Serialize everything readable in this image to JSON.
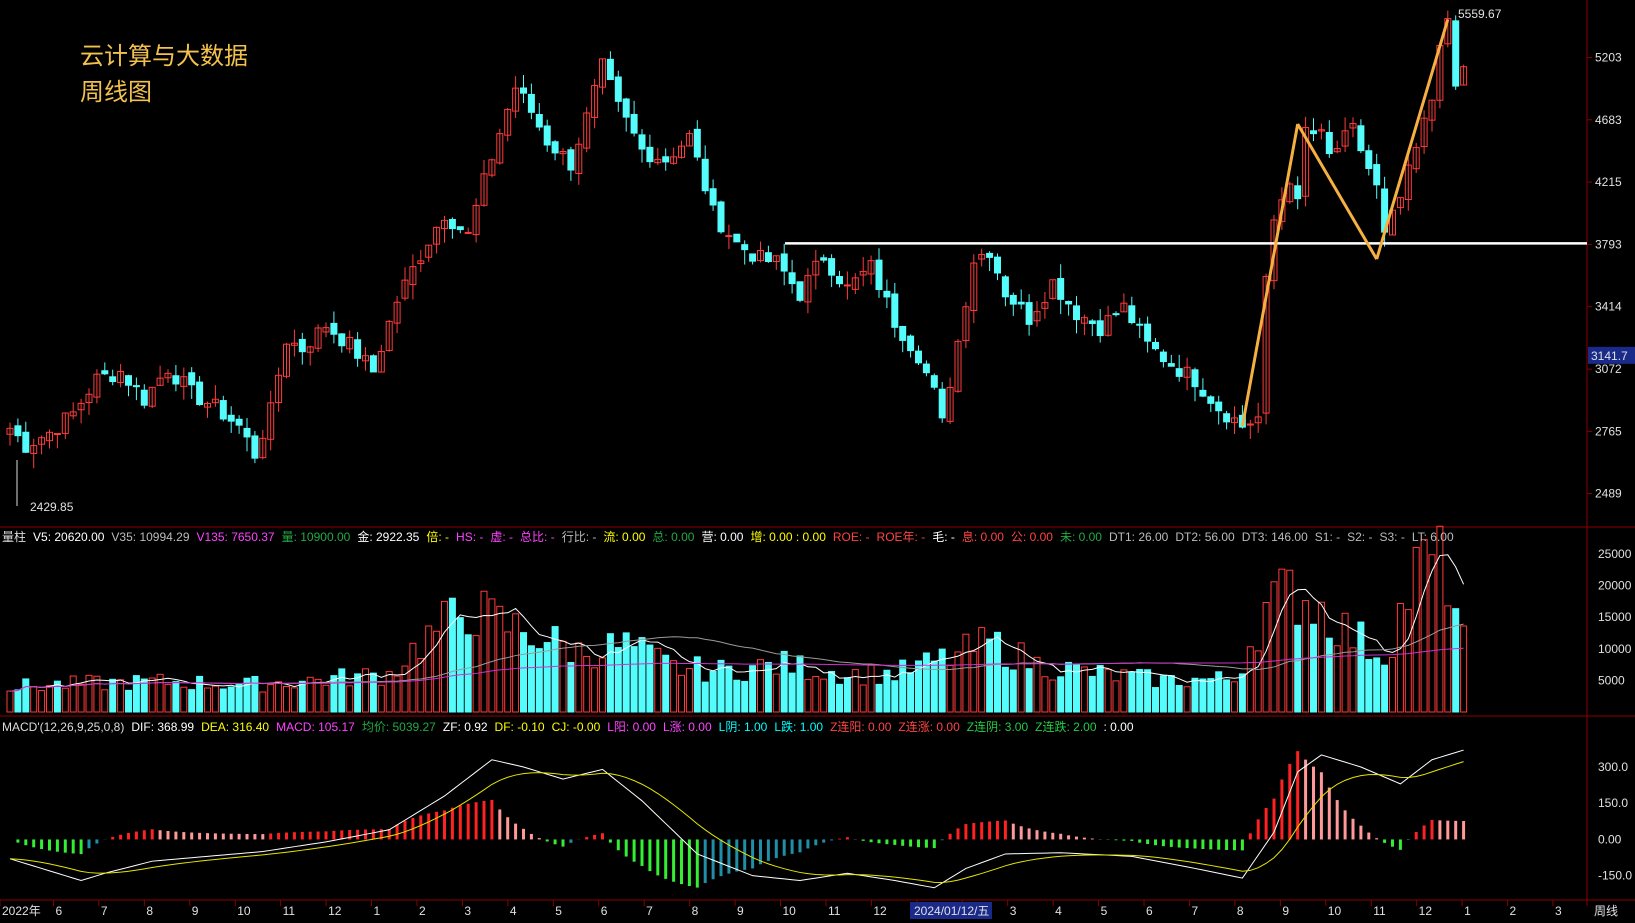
{
  "title": {
    "line1": "云计算与大数据",
    "line2": "周线图"
  },
  "price_axis": {
    "ticks": [
      "5203",
      "4683",
      "4215",
      "3793",
      "3414",
      "3072",
      "2765",
      "2489"
    ],
    "current": "3141.7",
    "high_label": "5559.67",
    "low_label": "2429.85"
  },
  "volume_axis": {
    "ticks": [
      "25000",
      "20000",
      "15000",
      "10000",
      "5000"
    ]
  },
  "macd_axis": {
    "ticks": [
      "300.0",
      "150.0",
      "0.00",
      "-150.0"
    ]
  },
  "vol_stats": [
    {
      "t": "量柱",
      "c": "#dddddd"
    },
    {
      "t": "V5: 20620.00",
      "c": "#ffffff"
    },
    {
      "t": "V35: 10994.29",
      "c": "#bbbbbb"
    },
    {
      "t": "V135: 7650.37",
      "c": "#ff44ff"
    },
    {
      "t": "量: 10900.00",
      "c": "#22aa44"
    },
    {
      "t": "金: 2922.35",
      "c": "#ffffff"
    },
    {
      "t": "倍: -",
      "c": "#ffff00"
    },
    {
      "t": "HS: -",
      "c": "#ff44ff"
    },
    {
      "t": "虚: -",
      "c": "#ff44ff"
    },
    {
      "t": "总比: -",
      "c": "#ff44ff"
    },
    {
      "t": "行比: -",
      "c": "#bbbbbb"
    },
    {
      "t": "流: 0.00",
      "c": "#ffff00"
    },
    {
      "t": "总: 0.00",
      "c": "#22aa44"
    },
    {
      "t": "营: 0.00",
      "c": "#ffffff"
    },
    {
      "t": "增: 0.00 : 0.00",
      "c": "#ffff00"
    },
    {
      "t": "ROE: -",
      "c": "#ff4444"
    },
    {
      "t": "ROE年: -",
      "c": "#ff4444"
    },
    {
      "t": "毛: -",
      "c": "#ffffff"
    },
    {
      "t": "息: 0.00",
      "c": "#ff4444"
    },
    {
      "t": "公: 0.00",
      "c": "#ff4444"
    },
    {
      "t": "未: 0.00",
      "c": "#22aa44"
    },
    {
      "t": "DT1: 26.00",
      "c": "#bbbbbb"
    },
    {
      "t": "DT2: 56.00",
      "c": "#bbbbbb"
    },
    {
      "t": "DT3: 146.00",
      "c": "#bbbbbb"
    },
    {
      "t": "S1: -",
      "c": "#bbbbbb"
    },
    {
      "t": "S2: -",
      "c": "#bbbbbb"
    },
    {
      "t": "S3: -",
      "c": "#bbbbbb"
    },
    {
      "t": "LT: 6.00",
      "c": "#bbbbbb"
    }
  ],
  "macd_stats": [
    {
      "t": "MACD'(12,26,9,25,0,8)",
      "c": "#dddddd"
    },
    {
      "t": "DIF: 368.99",
      "c": "#ffffff"
    },
    {
      "t": "DEA: 316.40",
      "c": "#ffff00"
    },
    {
      "t": "MACD: 105.17",
      "c": "#ff44ff"
    },
    {
      "t": "均价: 5039.27",
      "c": "#22aa44"
    },
    {
      "t": "ZF: 0.92",
      "c": "#ffffff"
    },
    {
      "t": "DF: -0.10",
      "c": "#ffff00"
    },
    {
      "t": "CJ: -0.00",
      "c": "#ffff00"
    },
    {
      "t": "L阳: 0.00",
      "c": "#ff44ff"
    },
    {
      "t": "L涨: 0.00",
      "c": "#ff44ff"
    },
    {
      "t": "L阴: 1.00",
      "c": "#00ffff"
    },
    {
      "t": "L跌: 1.00",
      "c": "#00ffff"
    },
    {
      "t": "Z连阳: 0.00",
      "c": "#ff4444"
    },
    {
      "t": "Z连涨: 0.00",
      "c": "#ff4444"
    },
    {
      "t": "Z连阴: 3.00",
      "c": "#22cc44"
    },
    {
      "t": "Z连跌: 2.00",
      "c": "#22cc44"
    },
    {
      "t": ": 0.00",
      "c": "#ffffff"
    }
  ],
  "x_axis": {
    "labels": [
      "2022年",
      "6",
      "7",
      "8",
      "9",
      "10",
      "11",
      "12",
      "1",
      "2",
      "3",
      "4",
      "5",
      "6",
      "7",
      "8",
      "9",
      "10",
      "11",
      "12",
      "1",
      "2",
      "3",
      "4",
      "5",
      "6",
      "7",
      "8",
      "9",
      "10",
      "11",
      "12",
      "1",
      "2",
      "3"
    ],
    "cursor_date": "2024/01/12/五",
    "period": "周线"
  },
  "colors": {
    "up": "#ff3b3b",
    "down": "#54fcfc",
    "support_line": "#ffffff",
    "arrow": "#f5b041",
    "dif": "#ffffff",
    "dea": "#e5e500"
  },
  "chart_data": {
    "type": "candlestick",
    "support_level": 3800,
    "ylim_price": [
      2380,
      5620
    ],
    "ylim_volume": [
      0,
      28000
    ],
    "ylim_macd": [
      -230,
      420
    ],
    "anchors": [
      [
        0,
        2780
      ],
      [
        2,
        2700
      ],
      [
        5,
        2760
      ],
      [
        8,
        2850
      ],
      [
        11,
        3020
      ],
      [
        14,
        3060
      ],
      [
        17,
        2920
      ],
      [
        20,
        3080
      ],
      [
        23,
        2950
      ],
      [
        26,
        2880
      ],
      [
        29,
        2790
      ],
      [
        31,
        2660
      ],
      [
        33,
        2860
      ],
      [
        35,
        3230
      ],
      [
        37,
        3180
      ],
      [
        40,
        3310
      ],
      [
        43,
        3200
      ],
      [
        46,
        3060
      ],
      [
        49,
        3450
      ],
      [
        52,
        3730
      ],
      [
        55,
        4000
      ],
      [
        58,
        3850
      ],
      [
        61,
        4400
      ],
      [
        64,
        4950
      ],
      [
        66,
        4750
      ],
      [
        68,
        4520
      ],
      [
        71,
        4350
      ],
      [
        73,
        4700
      ],
      [
        75,
        5120
      ],
      [
        77,
        4780
      ],
      [
        80,
        4450
      ],
      [
        83,
        4380
      ],
      [
        86,
        4550
      ],
      [
        89,
        4000
      ],
      [
        92,
        3800
      ],
      [
        95,
        3700
      ],
      [
        97,
        3680
      ],
      [
        100,
        3490
      ],
      [
        103,
        3720
      ],
      [
        106,
        3520
      ],
      [
        109,
        3650
      ],
      [
        112,
        3330
      ],
      [
        115,
        3150
      ],
      [
        117,
        2950
      ],
      [
        118,
        2800
      ],
      [
        120,
        3220
      ],
      [
        122,
        3700
      ],
      [
        124,
        3760
      ],
      [
        126,
        3500
      ],
      [
        129,
        3350
      ],
      [
        132,
        3560
      ],
      [
        135,
        3380
      ],
      [
        138,
        3300
      ],
      [
        141,
        3410
      ],
      [
        144,
        3200
      ],
      [
        147,
        3100
      ],
      [
        150,
        3020
      ],
      [
        153,
        2880
      ],
      [
        156,
        2790
      ],
      [
        158,
        2830
      ],
      [
        159,
        3550
      ],
      [
        160,
        3950
      ],
      [
        162,
        4250
      ],
      [
        163,
        4050
      ],
      [
        164,
        4600
      ],
      [
        166,
        4550
      ],
      [
        167,
        4400
      ],
      [
        170,
        4600
      ],
      [
        173,
        4170
      ],
      [
        174,
        3840
      ],
      [
        176,
        4100
      ],
      [
        178,
        4450
      ],
      [
        180,
        4850
      ],
      [
        181,
        5380
      ],
      [
        182,
        5480
      ],
      [
        183,
        4950
      ],
      [
        184,
        5100
      ]
    ],
    "volume_anchors": [
      [
        0,
        4000
      ],
      [
        10,
        4500
      ],
      [
        20,
        4800
      ],
      [
        30,
        4300
      ],
      [
        40,
        5200
      ],
      [
        48,
        6000
      ],
      [
        52,
        11000
      ],
      [
        58,
        16500
      ],
      [
        62,
        14000
      ],
      [
        66,
        12500
      ],
      [
        72,
        9500
      ],
      [
        78,
        10500
      ],
      [
        84,
        7000
      ],
      [
        90,
        6500
      ],
      [
        98,
        7500
      ],
      [
        106,
        6000
      ],
      [
        112,
        6000
      ],
      [
        120,
        9000
      ],
      [
        124,
        11000
      ],
      [
        130,
        7500
      ],
      [
        138,
        6000
      ],
      [
        146,
        5000
      ],
      [
        155,
        5200
      ],
      [
        159,
        16500
      ],
      [
        162,
        19000
      ],
      [
        165,
        17500
      ],
      [
        170,
        12000
      ],
      [
        174,
        9000
      ],
      [
        178,
        22000
      ],
      [
        180,
        24000
      ],
      [
        182,
        22000
      ],
      [
        184,
        11000
      ]
    ],
    "macd_anchors": [
      [
        0,
        -80
      ],
      [
        5,
        -130
      ],
      [
        9,
        -170
      ],
      [
        12,
        -140
      ],
      [
        18,
        -90
      ],
      [
        25,
        -70
      ],
      [
        32,
        -50
      ],
      [
        40,
        -10
      ],
      [
        48,
        40
      ],
      [
        55,
        180
      ],
      [
        61,
        330
      ],
      [
        65,
        300
      ],
      [
        70,
        250
      ],
      [
        75,
        290
      ],
      [
        80,
        160
      ],
      [
        87,
        -60
      ],
      [
        94,
        -150
      ],
      [
        100,
        -170
      ],
      [
        106,
        -140
      ],
      [
        112,
        -170
      ],
      [
        117,
        -200
      ],
      [
        121,
        -120
      ],
      [
        126,
        -60
      ],
      [
        133,
        -55
      ],
      [
        142,
        -70
      ],
      [
        150,
        -120
      ],
      [
        156,
        -160
      ],
      [
        160,
        30
      ],
      [
        163,
        280
      ],
      [
        166,
        350
      ],
      [
        171,
        300
      ],
      [
        176,
        230
      ],
      [
        180,
        330
      ],
      [
        184,
        370
      ]
    ]
  }
}
